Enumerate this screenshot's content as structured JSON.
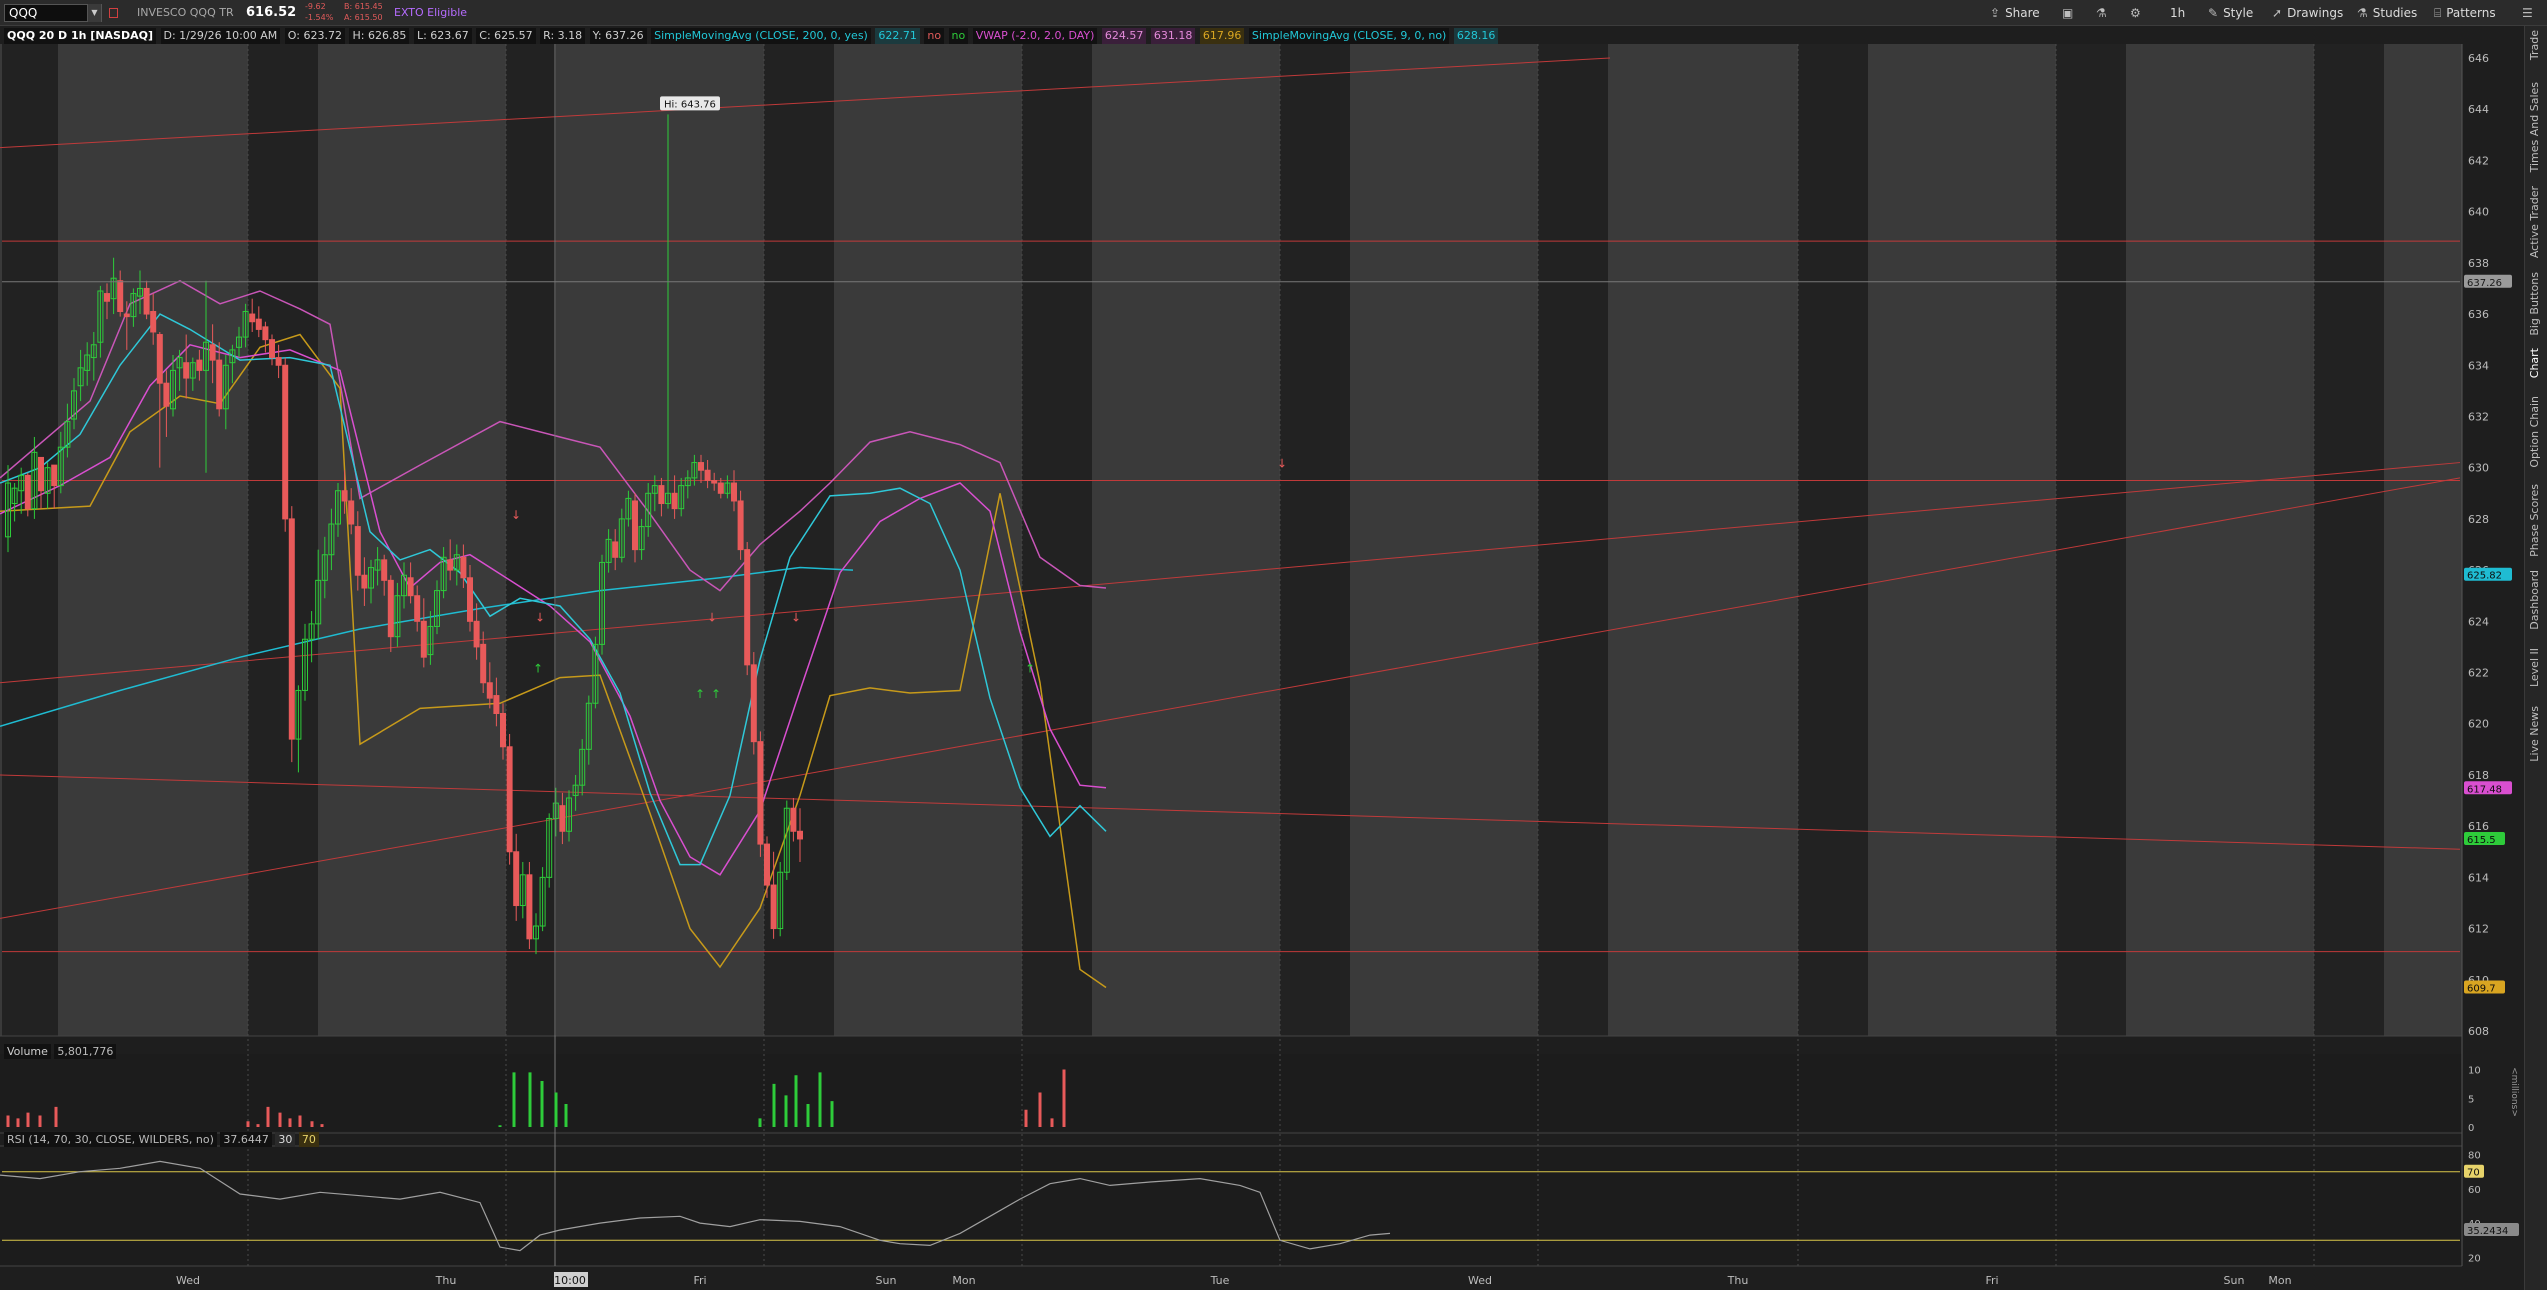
{
  "toolbar": {
    "symbol": "QQQ",
    "description": "INVESCO QQQ TR",
    "last_price": "616.52",
    "change": "-9.62",
    "change_pct": "-1.54%",
    "bid": "B: 615.45",
    "ask": "A: 615.50",
    "ext_badge": "EXTO Eligible",
    "buttons": [
      {
        "label": "Share",
        "icon": "share-icon"
      },
      {
        "label": "",
        "icon": "camera-icon"
      },
      {
        "label": "",
        "icon": "flask-icon"
      },
      {
        "label": "",
        "icon": "gear-icon"
      },
      {
        "label": "1h",
        "icon": ""
      },
      {
        "label": "Style",
        "icon": "style-icon"
      },
      {
        "label": "Drawings",
        "icon": "cursor-icon"
      },
      {
        "label": "Studies",
        "icon": "studies-icon"
      },
      {
        "label": "Patterns",
        "icon": "patterns-icon"
      }
    ]
  },
  "info_bar": {
    "chart_id": "QQQ 20 D 1h [NASDAQ]",
    "date": "D: 1/29/26 10:00 AM",
    "open": "O: 623.72",
    "high": "H: 626.85",
    "low": "L: 623.67",
    "close": "C: 625.57",
    "range": "R: 3.18",
    "y": "Y: 637.26",
    "sma200_label": "SimpleMovingAvg (CLOSE, 200, 0, yes)",
    "sma200_value": "622.71",
    "sma200_flag1": "no",
    "sma200_flag2": "no",
    "vwap_label": "VWAP (-2.0, 2.0, DAY)",
    "vwap_value": "624.57",
    "vwap_upper": "631.18",
    "vwap_lower": "617.96",
    "sma9_label": "SimpleMovingAvg (CLOSE, 9, 0, no)",
    "sma9_value": "628.16"
  },
  "price_axis": {
    "ticks": [
      "646",
      "644",
      "642",
      "640",
      "638",
      "636",
      "634",
      "632",
      "630",
      "628",
      "626",
      "624",
      "622",
      "620",
      "618",
      "616",
      "614",
      "612",
      "610",
      "608"
    ],
    "tags": [
      {
        "label": "637.26",
        "price": 637.26,
        "color": "#9a9a9a",
        "text_color": "#1a1a1a"
      },
      {
        "label": "625.82",
        "price": 625.82,
        "color": "#1fbcd2",
        "text_color": "#0e0e0e"
      },
      {
        "label": "617.48",
        "price": 617.48,
        "color": "#d94fd0",
        "text_color": "#0e0e0e"
      },
      {
        "label": "615.5",
        "price": 615.5,
        "color": "#2ecc3a",
        "text_color": "#0e0e0e"
      },
      {
        "label": "609.7",
        "price": 609.7,
        "color": "#d9a521",
        "text_color": "#0e0e0e"
      }
    ]
  },
  "high_label": "Hi: 643.76",
  "volume_panel": {
    "label": "Volume",
    "value": "5,801,776",
    "axis_ticks": [
      "10",
      "5",
      "0"
    ],
    "unit": "<millions>"
  },
  "rsi_panel": {
    "label": "RSI (14, 70, 30, CLOSE, WILDERS, no)",
    "value": "37.6447",
    "lower": "30",
    "upper": "70",
    "axis_ticks": [
      "80",
      "60",
      "40",
      "20"
    ],
    "upper_tag": "70",
    "value_tag": "35.2434"
  },
  "time_axis": {
    "labels": [
      "Wed",
      "Thu",
      "10:00",
      "Fri",
      "Sun",
      "Mon",
      "Tue",
      "Wed",
      "Thu",
      "Fri",
      "Sun",
      "Mon"
    ],
    "crosshair_label": "10:00"
  },
  "right_tabs": [
    "Trade",
    "Times And Sales",
    "Active Trader",
    "Big Buttons",
    "Chart",
    "Option Chain",
    "Phase Scores",
    "Dashboard",
    "Level II",
    "Live News"
  ],
  "chart_data": {
    "type": "candlestick",
    "symbol": "QQQ",
    "interval": "1h",
    "ylim": [
      607.5,
      646.5
    ],
    "horizontal_levels": [
      638.85,
      629.5,
      611.1
    ],
    "crosshair_price": 637.26,
    "candles": [
      [
        627.3,
        630.1,
        626.7,
        629.4
      ],
      [
        628.6,
        629.4,
        627.9,
        629.2
      ],
      [
        629.1,
        630.0,
        628.2,
        629.7
      ],
      [
        629.7,
        629.8,
        628.1,
        628.4
      ],
      [
        628.4,
        631.2,
        628.0,
        630.6
      ],
      [
        630.4,
        630.4,
        628.4,
        629.1
      ],
      [
        629.0,
        630.2,
        628.4,
        630.0
      ],
      [
        630.1,
        630.1,
        628.4,
        629.3
      ],
      [
        629.3,
        631.4,
        629.0,
        630.8
      ],
      [
        630.8,
        632.5,
        630.4,
        631.8
      ],
      [
        631.9,
        633.5,
        631.5,
        633.0
      ],
      [
        633.2,
        634.6,
        632.6,
        633.9
      ],
      [
        633.8,
        634.9,
        633.2,
        634.4
      ],
      [
        634.3,
        635.3,
        633.4,
        634.8
      ],
      [
        634.9,
        637.1,
        634.3,
        636.9
      ],
      [
        636.8,
        637.2,
        635.8,
        636.5
      ],
      [
        636.6,
        638.2,
        636.0,
        637.4
      ],
      [
        637.3,
        637.7,
        635.9,
        636.1
      ],
      [
        636.0,
        636.5,
        634.6,
        635.9
      ],
      [
        635.9,
        637.0,
        635.5,
        636.8
      ],
      [
        636.7,
        637.7,
        636.0,
        637.0
      ],
      [
        637.0,
        637.3,
        635.8,
        636.0
      ],
      [
        636.1,
        636.8,
        634.8,
        635.3
      ],
      [
        635.2,
        635.3,
        630.0,
        633.3
      ],
      [
        633.3,
        633.8,
        631.2,
        632.4
      ],
      [
        632.3,
        634.4,
        632.0,
        633.8
      ],
      [
        633.9,
        634.6,
        633.0,
        634.3
      ],
      [
        634.1,
        635.2,
        632.7,
        633.5
      ],
      [
        633.5,
        634.3,
        633.0,
        634.1
      ],
      [
        634.2,
        634.6,
        633.4,
        633.8
      ],
      [
        633.8,
        637.3,
        629.8,
        634.9
      ],
      [
        634.8,
        635.6,
        633.3,
        634.2
      ],
      [
        634.2,
        634.9,
        632.0,
        632.3
      ],
      [
        632.3,
        634.4,
        631.5,
        634.0
      ],
      [
        634.1,
        634.8,
        633.3,
        634.6
      ],
      [
        634.7,
        635.5,
        634.3,
        635.1
      ],
      [
        635.1,
        636.4,
        634.7,
        636.1
      ],
      [
        636.0,
        636.6,
        635.3,
        635.7
      ],
      [
        635.8,
        636.3,
        635.1,
        635.4
      ],
      [
        635.5,
        635.7,
        634.5,
        635.0
      ],
      [
        635.0,
        635.2,
        634.0,
        634.3
      ],
      [
        634.3,
        634.8,
        633.5,
        634.0
      ],
      [
        634.0,
        634.3,
        627.5,
        628.0
      ],
      [
        628.0,
        628.5,
        618.5,
        619.4
      ],
      [
        619.4,
        621.5,
        618.1,
        621.3
      ],
      [
        621.3,
        623.9,
        620.9,
        623.3
      ],
      [
        623.3,
        624.4,
        622.4,
        623.9
      ],
      [
        623.9,
        626.8,
        623.3,
        625.6
      ],
      [
        625.6,
        627.3,
        624.9,
        626.6
      ],
      [
        626.6,
        628.4,
        626.0,
        627.8
      ],
      [
        627.8,
        629.4,
        627.3,
        629.1
      ],
      [
        629.1,
        629.9,
        628.2,
        628.7
      ],
      [
        628.7,
        629.2,
        627.4,
        627.8
      ],
      [
        627.7,
        628.3,
        625.2,
        625.8
      ],
      [
        625.8,
        626.5,
        624.6,
        625.3
      ],
      [
        625.3,
        626.4,
        624.7,
        626.1
      ],
      [
        626.0,
        626.9,
        625.4,
        626.4
      ],
      [
        626.4,
        626.6,
        625.0,
        625.6
      ],
      [
        625.6,
        625.8,
        622.8,
        623.4
      ],
      [
        623.4,
        625.5,
        623.0,
        625.0
      ],
      [
        625.0,
        626.3,
        624.5,
        625.8
      ],
      [
        625.7,
        626.3,
        624.7,
        625.0
      ],
      [
        625.0,
        625.4,
        623.6,
        624.0
      ],
      [
        624.0,
        624.9,
        622.2,
        622.6
      ],
      [
        622.7,
        624.4,
        622.3,
        623.8
      ],
      [
        623.8,
        625.6,
        623.5,
        625.2
      ],
      [
        625.2,
        626.9,
        624.9,
        626.5
      ],
      [
        626.4,
        627.2,
        625.6,
        626.0
      ],
      [
        626.0,
        627.0,
        625.4,
        626.6
      ],
      [
        626.5,
        627.0,
        625.3,
        625.7
      ],
      [
        625.7,
        626.2,
        623.6,
        624.0
      ],
      [
        624.0,
        624.7,
        622.5,
        623.0
      ],
      [
        623.1,
        623.6,
        621.2,
        621.6
      ],
      [
        621.6,
        622.4,
        620.6,
        621.0
      ],
      [
        621.1,
        621.8,
        619.9,
        620.4
      ],
      [
        620.4,
        620.8,
        618.6,
        619.1
      ],
      [
        619.1,
        619.6,
        614.5,
        615.0
      ],
      [
        615.0,
        615.7,
        612.3,
        612.9
      ],
      [
        612.9,
        614.6,
        612.4,
        614.1
      ],
      [
        614.1,
        614.6,
        611.2,
        611.6
      ],
      [
        611.6,
        612.6,
        611.0,
        612.1
      ],
      [
        612.1,
        614.4,
        611.9,
        614.0
      ],
      [
        614.0,
        616.5,
        613.6,
        616.3
      ],
      [
        616.3,
        617.5,
        615.6,
        616.9
      ],
      [
        616.8,
        617.3,
        615.3,
        615.8
      ],
      [
        615.8,
        617.4,
        615.4,
        617.1
      ],
      [
        617.2,
        618.0,
        616.6,
        617.6
      ],
      [
        617.6,
        619.4,
        617.2,
        619.0
      ],
      [
        619.0,
        621.1,
        618.4,
        620.8
      ],
      [
        620.8,
        623.4,
        620.6,
        623.1
      ],
      [
        623.1,
        626.6,
        622.7,
        626.3
      ],
      [
        626.3,
        627.6,
        625.9,
        627.2
      ],
      [
        627.1,
        627.6,
        626.0,
        626.5
      ],
      [
        626.5,
        628.4,
        626.3,
        628.0
      ],
      [
        628.0,
        629.1,
        627.7,
        628.8
      ],
      [
        628.7,
        629.0,
        626.3,
        626.8
      ],
      [
        626.8,
        628.0,
        626.4,
        627.7
      ],
      [
        627.7,
        629.4,
        627.3,
        629.0
      ],
      [
        629.0,
        629.7,
        628.3,
        629.3
      ],
      [
        629.3,
        629.6,
        628.1,
        628.6
      ],
      [
        628.6,
        643.8,
        628.4,
        629.0
      ],
      [
        629.0,
        629.7,
        628.0,
        628.4
      ],
      [
        628.4,
        629.6,
        628.1,
        629.3
      ],
      [
        629.3,
        629.9,
        628.8,
        629.6
      ],
      [
        629.6,
        630.5,
        629.3,
        630.2
      ],
      [
        630.2,
        630.5,
        629.4,
        629.9
      ],
      [
        629.9,
        630.3,
        629.2,
        629.5
      ],
      [
        629.5,
        629.8,
        629.1,
        629.4
      ],
      [
        629.4,
        629.6,
        628.8,
        629.0
      ],
      [
        629.0,
        629.7,
        628.8,
        629.4
      ],
      [
        629.4,
        629.9,
        628.3,
        628.7
      ],
      [
        628.7,
        629.1,
        626.4,
        626.8
      ],
      [
        626.8,
        627.1,
        621.9,
        622.3
      ],
      [
        622.3,
        622.8,
        618.8,
        619.3
      ],
      [
        619.3,
        619.7,
        614.8,
        615.3
      ],
      [
        615.3,
        615.6,
        613.2,
        613.7
      ],
      [
        613.7,
        615.0,
        611.6,
        612.0
      ],
      [
        612.0,
        614.6,
        611.7,
        614.2
      ],
      [
        614.2,
        617.0,
        613.9,
        616.7
      ],
      [
        616.7,
        617.1,
        615.4,
        615.8
      ],
      [
        615.8,
        616.7,
        614.6,
        615.5
      ]
    ],
    "sma200": [
      [
        0,
        619.9
      ],
      [
        120,
        621.3
      ],
      [
        240,
        622.6
      ],
      [
        360,
        623.7
      ],
      [
        480,
        624.5
      ],
      [
        600,
        625.2
      ],
      [
        720,
        625.7
      ],
      [
        800,
        626.1
      ],
      [
        853,
        626.0
      ]
    ],
    "sma9": [
      [
        0,
        629.4
      ],
      [
        40,
        630.0
      ],
      [
        80,
        631.3
      ],
      [
        120,
        634.0
      ],
      [
        160,
        636.0
      ],
      [
        190,
        635.4
      ],
      [
        240,
        634.2
      ],
      [
        290,
        634.3
      ],
      [
        330,
        634.0
      ],
      [
        370,
        627.5
      ],
      [
        400,
        626.4
      ],
      [
        430,
        626.8
      ],
      [
        460,
        625.9
      ],
      [
        490,
        624.2
      ],
      [
        520,
        624.9
      ],
      [
        560,
        624.6
      ],
      [
        590,
        623.3
      ],
      [
        620,
        621.2
      ],
      [
        650,
        617.3
      ],
      [
        680,
        614.5
      ],
      [
        700,
        614.5
      ],
      [
        730,
        617.2
      ],
      [
        760,
        622.5
      ],
      [
        790,
        626.5
      ],
      [
        830,
        628.9
      ],
      [
        870,
        629.0
      ],
      [
        900,
        629.2
      ],
      [
        930,
        628.6
      ],
      [
        960,
        626.0
      ],
      [
        990,
        621.0
      ],
      [
        1020,
        617.5
      ],
      [
        1050,
        615.6
      ],
      [
        1080,
        616.8
      ],
      [
        1106,
        615.8
      ]
    ],
    "vwap": [
      [
        0,
        628.2
      ],
      [
        60,
        629.3
      ],
      [
        110,
        630.4
      ],
      [
        150,
        633.2
      ],
      [
        190,
        634.8
      ],
      [
        240,
        634.3
      ],
      [
        290,
        634.6
      ],
      [
        340,
        633.8
      ],
      [
        380,
        627.5
      ],
      [
        410,
        625.3
      ],
      [
        440,
        626.3
      ],
      [
        470,
        626.6
      ],
      [
        510,
        625.6
      ],
      [
        550,
        624.6
      ],
      [
        590,
        623.2
      ],
      [
        630,
        620.3
      ],
      [
        660,
        617.0
      ],
      [
        690,
        614.8
      ],
      [
        720,
        614.1
      ],
      [
        760,
        616.6
      ],
      [
        800,
        621.3
      ],
      [
        840,
        625.9
      ],
      [
        880,
        627.9
      ],
      [
        920,
        628.8
      ],
      [
        960,
        629.4
      ],
      [
        990,
        628.3
      ],
      [
        1020,
        623.6
      ],
      [
        1050,
        619.8
      ],
      [
        1080,
        617.6
      ],
      [
        1106,
        617.5
      ]
    ],
    "vwap_upper": [
      [
        0,
        629.6
      ],
      [
        90,
        632.6
      ],
      [
        130,
        636.4
      ],
      [
        180,
        637.3
      ],
      [
        220,
        636.4
      ],
      [
        260,
        636.9
      ],
      [
        300,
        636.2
      ],
      [
        330,
        635.6
      ],
      [
        360,
        628.8
      ],
      [
        420,
        630.1
      ],
      [
        500,
        631.8
      ],
      [
        560,
        631.2
      ],
      [
        600,
        630.8
      ],
      [
        650,
        628.2
      ],
      [
        690,
        626.0
      ],
      [
        720,
        625.2
      ],
      [
        760,
        627.0
      ],
      [
        800,
        628.3
      ],
      [
        830,
        629.4
      ],
      [
        870,
        631.0
      ],
      [
        910,
        631.4
      ],
      [
        960,
        630.9
      ],
      [
        1000,
        630.2
      ],
      [
        1040,
        626.5
      ],
      [
        1080,
        625.4
      ],
      [
        1106,
        625.3
      ]
    ],
    "vwap_lower": [
      [
        0,
        628.3
      ],
      [
        90,
        628.5
      ],
      [
        130,
        631.4
      ],
      [
        180,
        632.8
      ],
      [
        220,
        632.5
      ],
      [
        260,
        634.7
      ],
      [
        300,
        635.2
      ],
      [
        340,
        633.1
      ],
      [
        360,
        619.2
      ],
      [
        420,
        620.6
      ],
      [
        500,
        620.8
      ],
      [
        560,
        621.8
      ],
      [
        600,
        621.9
      ],
      [
        650,
        616.5
      ],
      [
        690,
        612.0
      ],
      [
        720,
        610.5
      ],
      [
        760,
        612.8
      ],
      [
        800,
        617.2
      ],
      [
        830,
        621.1
      ],
      [
        870,
        621.4
      ],
      [
        910,
        621.2
      ],
      [
        960,
        621.3
      ],
      [
        1000,
        629.0
      ],
      [
        1040,
        621.6
      ],
      [
        1080,
        610.4
      ],
      [
        1106,
        609.7
      ]
    ],
    "trend_lines": [
      {
        "from": [
          0,
          642.5
        ],
        "to": [
          1610,
          646.0
        ]
      },
      {
        "from": [
          0,
          621.6
        ],
        "to": [
          2460,
          630.2
        ]
      },
      {
        "from": [
          0,
          612.4
        ],
        "to": [
          2460,
          629.6
        ]
      },
      {
        "from": [
          0,
          618.0
        ],
        "to": [
          2460,
          615.1
        ]
      }
    ],
    "volume_millions": [
      2.0,
      1.5,
      2.5,
      2.0,
      3.5,
      1.0,
      0.5,
      3.5,
      2.5,
      1.5,
      2.0,
      1.0,
      0.5,
      0.3,
      9.5,
      9.5,
      8.0,
      6.0,
      4.0,
      1.5,
      7.5,
      5.5,
      9.0,
      4.0,
      9.5,
      4.5,
      3.0,
      6.0,
      1.5,
      10.0
    ]
  }
}
